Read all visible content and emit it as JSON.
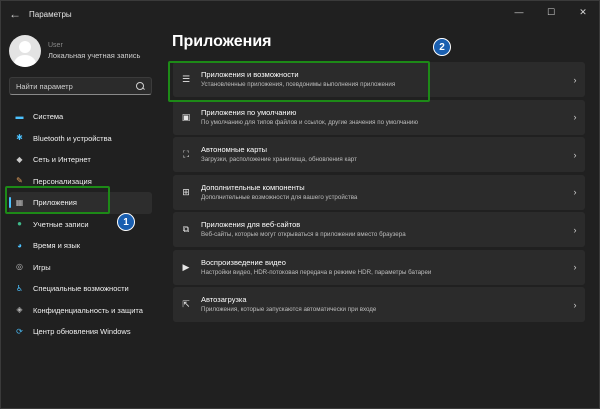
{
  "window": {
    "title": "Параметры",
    "back_glyph": "←",
    "minimize_glyph": "—",
    "maximize_glyph": "☐",
    "close_glyph": "✕"
  },
  "profile": {
    "name": "User",
    "account_type": "Локальная учетная запись"
  },
  "search": {
    "placeholder": "Найти параметр"
  },
  "sidebar": {
    "items": [
      {
        "label": "Система",
        "icon": "monitor-icon",
        "glyph": "▬",
        "color": "#4cc2ff"
      },
      {
        "label": "Bluetooth и устройства",
        "icon": "bluetooth-icon",
        "glyph": "✱",
        "color": "#4cc2ff"
      },
      {
        "label": "Сеть и Интернет",
        "icon": "wifi-icon",
        "glyph": "◆",
        "color": "#c9c9c9"
      },
      {
        "label": "Персонализация",
        "icon": "brush-icon",
        "glyph": "✎",
        "color": "#e8a25c"
      },
      {
        "label": "Приложения",
        "icon": "apps-icon",
        "glyph": "▦",
        "color": "#b9b9b9"
      },
      {
        "label": "Учетные записи",
        "icon": "person-icon",
        "glyph": "●",
        "color": "#3fb98a"
      },
      {
        "label": "Время и язык",
        "icon": "globe-clock-icon",
        "glyph": "◕",
        "color": "#4cc2ff"
      },
      {
        "label": "Игры",
        "icon": "gamepad-icon",
        "glyph": "◎",
        "color": "#b9b9b9"
      },
      {
        "label": "Специальные возможности",
        "icon": "accessibility-icon",
        "glyph": "♿",
        "color": "#4cc2ff"
      },
      {
        "label": "Конфиденциальность и защита",
        "icon": "shield-icon",
        "glyph": "◈",
        "color": "#b9b9b9"
      },
      {
        "label": "Центр обновления Windows",
        "icon": "update-icon",
        "glyph": "⟳",
        "color": "#4cc2ff"
      }
    ],
    "active_index": 4
  },
  "annotations": {
    "badge_1": "1",
    "badge_2": "2",
    "highlight_color": "#1d8a17",
    "badge_color": "#1a5fb0"
  },
  "main": {
    "title": "Приложения",
    "cards": [
      {
        "title": "Приложения и возможности",
        "desc": "Установленные приложения, псевдонимы выполнения приложения",
        "icon": "list-icon",
        "glyph": "☰"
      },
      {
        "title": "Приложения по умолчанию",
        "desc": "По умолчанию для типов файлов и ссылок, другие значения по умолчанию",
        "icon": "default-apps-icon",
        "glyph": "▣"
      },
      {
        "title": "Автономные карты",
        "desc": "Загрузки, расположение хранилища, обновления карт",
        "icon": "map-icon",
        "glyph": "⛶"
      },
      {
        "title": "Дополнительные компоненты",
        "desc": "Дополнительные возможности для вашего устройства",
        "icon": "components-icon",
        "glyph": "⊞"
      },
      {
        "title": "Приложения для веб-сайтов",
        "desc": "Веб-сайты, которые могут открываться в приложении вместо браузера",
        "icon": "web-app-icon",
        "glyph": "⧉"
      },
      {
        "title": "Воспроизведение видео",
        "desc": "Настройки видео, HDR-потоковая передача в режиме HDR, параметры батареи",
        "icon": "video-icon",
        "glyph": "▶"
      },
      {
        "title": "Автозагрузка",
        "desc": "Приложения, которые запускаются автоматически при входе",
        "icon": "startup-icon",
        "glyph": "⇱"
      }
    ],
    "chevron": "›"
  }
}
